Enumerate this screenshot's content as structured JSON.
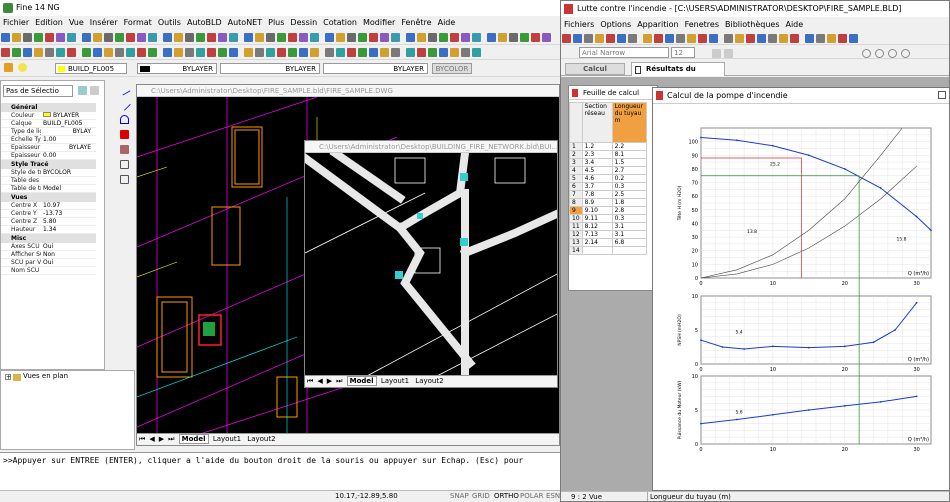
{
  "fine": {
    "title": "Fine 14 NG",
    "menu": [
      "Fichier",
      "Edition",
      "Vue",
      "Insérer",
      "Format",
      "Outils",
      "AutoBLD",
      "AutoNET",
      "Plus",
      "Dessin",
      "Cotation",
      "Modifier",
      "Fenêtre",
      "Aide"
    ],
    "layer_name": "BUILD_FL005",
    "linetype1": "BYLAYER",
    "linetype2": "BYLAYER",
    "linetype3": "BYLAYER",
    "color_btn": "BYCOLOR",
    "selector": "Pas de Sélectio",
    "props": {
      "general": "Général",
      "couleur_k": "Couleur",
      "couleur_v": "BYLAYER",
      "calque_k": "Calque",
      "calque_v": "BUILD_FL005",
      "type_k": "Type de ligne",
      "type_v": "BYLAY",
      "echelle_k": "Echelle Typ...",
      "echelle_v": "1.00",
      "epaisseur_k": "Epaisseur li",
      "epaisseur_v": "BYLAYE",
      "epaisseur2_k": "Epaisseur",
      "epaisseur2_v": "0.00",
      "style": "Style Tracé",
      "style_k": "Style de tracé",
      "style_v": "BYCOLOR",
      "table_k": "Table des s...",
      "table_v": "",
      "table2_k": "Table de tr...",
      "table2_v": "Model",
      "vues": "Vues",
      "cx_k": "Centre X",
      "cx_v": "10.97",
      "cy_k": "Centre Y",
      "cy_v": "-13.73",
      "cz_k": "Centre Z",
      "cz_v": "5.80",
      "h_k": "Hauteur",
      "h_v": "1.34",
      "misc": "Misc",
      "axes_k": "Axes SCU A...",
      "axes_v": "Oui",
      "aff_k": "Afficher SC...",
      "aff_v": "Non",
      "scu_k": "SCU par Vue",
      "scu_v": "Oui",
      "nom_k": "Nom SCU",
      "nom_v": ""
    },
    "tree_item": "Vues en plan",
    "dwg1_title": "C:\\Users\\Administrator\\Desktop\\FIRE_SAMPLE.bld\\FIRE_SAMPLE.DWG",
    "dwg2_title": "C:\\Users\\Administrator\\Desktop\\BUILDING_FIRE_NETWORK.bld\\BUI...",
    "tab_model": "Model",
    "tab_layout1": "Layout1",
    "tab_layout2": "Layout2",
    "command": ">>Appuyer sur ENTREE (ENTER), cliquer a l'aide du bouton droit de la souris ou appuyer sur Echap. (Esc) pour",
    "status_coords": "10.17,-12.89,5.80",
    "status_btns": [
      "SNAP",
      "GRID",
      "ORTHO",
      "POLAR",
      "ESN"
    ]
  },
  "lutte": {
    "title": "Lutte contre l'incendie - [C:\\USERS\\ADMINISTRATOR\\DESKTOP\\FIRE_SAMPLE.BLD]",
    "menu": [
      "Fichiers",
      "Options",
      "Apparition",
      "Fenetres",
      "Bibliothèques",
      "Aide"
    ],
    "font": "Arial Narrow",
    "size": "12",
    "tab_calcul": "Calcul",
    "tab_resultats": "Résultats du Groupe",
    "sheet_title": "Feuille de calcul",
    "col1": "Section réseau",
    "col2": "Longueur du tuyau m",
    "rows": [
      [
        "1",
        "1.2",
        "2.2"
      ],
      [
        "2",
        "2.3",
        "8.1"
      ],
      [
        "3",
        "3.4",
        "1.5"
      ],
      [
        "4",
        "4.5",
        "2.7"
      ],
      [
        "5",
        "4.6",
        "0.2"
      ],
      [
        "6",
        "3.7",
        "0.3"
      ],
      [
        "7",
        "7.8",
        "2.5"
      ],
      [
        "8",
        "8.9",
        "1.8"
      ],
      [
        "9",
        "9.10",
        "2.8"
      ],
      [
        "10",
        "9.11",
        "0.3"
      ],
      [
        "11",
        "8.12",
        "3.1"
      ],
      [
        "12",
        "7.13",
        "3.1"
      ],
      [
        "13",
        "2.14",
        "6.8"
      ],
      [
        "14",
        "",
        ""
      ]
    ],
    "pump_title": "Calcul de la pompe d'incendie",
    "status": "9 : 2   Vue",
    "status2": "Longueur du tuyau (m)"
  },
  "chart_data": [
    {
      "type": "line",
      "title": "",
      "ylabel": "Tête H (m H2O)",
      "xlabel": "Q (m³/h)",
      "xlim": [
        0,
        32
      ],
      "ylim": [
        0,
        110
      ],
      "yticks": [
        "0",
        "10",
        "20",
        "30",
        "40",
        "50",
        "60",
        "70",
        "80",
        "90",
        "100"
      ],
      "xticks": [
        "0",
        "10",
        "20",
        "30"
      ],
      "annotations": [
        "25.2",
        "13.8",
        "15.8"
      ],
      "series": [
        {
          "values_x": [
            0,
            5,
            10,
            15,
            20,
            25,
            30,
            32
          ],
          "values_y": [
            103,
            101,
            97,
            90,
            80,
            66,
            45,
            35
          ]
        },
        {
          "values_x": [
            0,
            5,
            10,
            15,
            20,
            25,
            28
          ],
          "values_y": [
            0,
            6,
            17,
            35,
            58,
            90,
            110
          ]
        },
        {
          "values_x": [
            0,
            5,
            10,
            15,
            20,
            25,
            30
          ],
          "values_y": [
            0,
            3,
            10,
            22,
            38,
            58,
            82
          ]
        }
      ]
    },
    {
      "type": "line",
      "title": "",
      "ylabel": "NPSH (mH2O)",
      "xlabel": "Q (m³/h)",
      "xlim": [
        0,
        32
      ],
      "ylim": [
        0,
        10
      ],
      "yticks": [
        "0",
        "5",
        "10"
      ],
      "xticks": [
        "0",
        "10",
        "20",
        "30"
      ],
      "annotations": [
        "5.4"
      ],
      "series": [
        {
          "values_x": [
            0,
            3,
            6,
            10,
            15,
            20,
            24,
            27,
            30
          ],
          "values_y": [
            3.5,
            2.5,
            2.2,
            2.6,
            2.4,
            2.6,
            3.2,
            5,
            9
          ]
        }
      ]
    },
    {
      "type": "line",
      "title": "",
      "ylabel": "Puissance du Moteur (kW)",
      "xlabel": "Q (m³/h)",
      "xlim": [
        0,
        32
      ],
      "ylim": [
        0,
        10
      ],
      "yticks": [
        "0",
        "5",
        "10"
      ],
      "xticks": [
        "0",
        "10",
        "20",
        "30"
      ],
      "annotations": [
        "5.6"
      ],
      "series": [
        {
          "values_x": [
            0,
            5,
            10,
            15,
            20,
            25,
            30
          ],
          "values_y": [
            3,
            3.6,
            4.3,
            5,
            5.6,
            6.2,
            7
          ]
        }
      ]
    }
  ]
}
